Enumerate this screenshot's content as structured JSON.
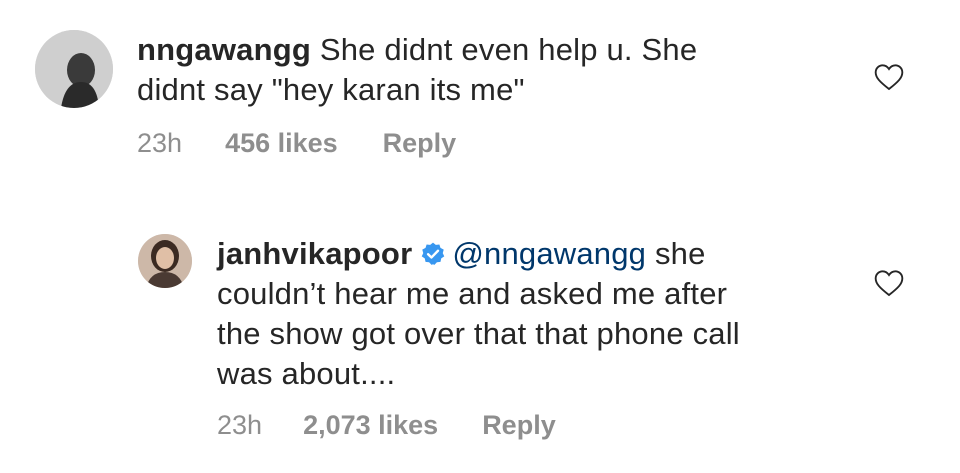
{
  "comments": [
    {
      "username": "nngawangg",
      "text_line1": " She didnt even help u. She",
      "text_line2": "didnt say \"hey karan its me\"",
      "time": "23h",
      "likes": "456 likes",
      "reply_label": "Reply"
    },
    {
      "username": "janhvikapoor",
      "mention": "@nngawangg",
      "text_line1": " she",
      "text_line2": "couldn’t hear me and asked me after",
      "text_line3": "the show got over that that phone call",
      "text_line4": "was about....",
      "time": "23h",
      "likes": "2,073 likes",
      "reply_label": "Reply",
      "verified": true
    }
  ],
  "colors": {
    "text": "#262626",
    "muted": "#8e8e8e",
    "mention": "#00376b",
    "verified": "#3897f0"
  },
  "icons": {
    "like": "heart-outline-icon",
    "verified": "verified-badge-icon"
  }
}
